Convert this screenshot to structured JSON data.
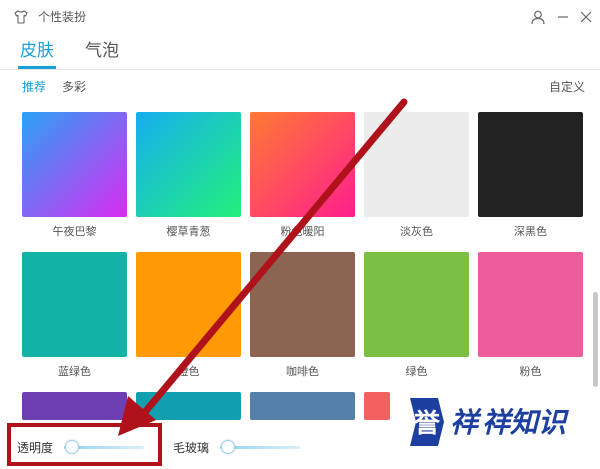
{
  "window": {
    "title": "个性装扮"
  },
  "main_tabs": [
    {
      "label": "皮肤"
    },
    {
      "label": "气泡"
    }
  ],
  "sub_tabs": [
    {
      "label": "推荐"
    },
    {
      "label": "多彩"
    }
  ],
  "custom_label": "自定义",
  "skins": [
    {
      "label": "午夜巴黎",
      "color_from": "#2aa2f5",
      "color_to": "#d92cf2"
    },
    {
      "label": "樱草青葱",
      "color_from": "#16aef0",
      "color_to": "#22f07a"
    },
    {
      "label": "粉色暖阳",
      "color_from": "#ff7a33",
      "color_to": "#ff1e8e"
    },
    {
      "label": "淡灰色",
      "color_from": "#ececec",
      "color_to": "#ececec"
    },
    {
      "label": "深黑色",
      "color_from": "#222222",
      "color_to": "#222222"
    },
    {
      "label": "蓝绿色",
      "color_from": "#12b3a6",
      "color_to": "#12b3a6"
    },
    {
      "label": "橙色",
      "color_from": "#ff9a05",
      "color_to": "#ff9a05"
    },
    {
      "label": "咖啡色",
      "color_from": "#8b6452",
      "color_to": "#8b6452"
    },
    {
      "label": "绿色",
      "color_from": "#7bc044",
      "color_to": "#7bc044"
    },
    {
      "label": "粉色",
      "color_from": "#ee5c9c",
      "color_to": "#ee5c9c"
    },
    {
      "label": "",
      "color_from": "#6d3fb3",
      "color_to": "#6d3fb3"
    },
    {
      "label": "",
      "color_from": "#12a0b0",
      "color_to": "#12a0b0"
    },
    {
      "label": "",
      "color_from": "#5580a8",
      "color_to": "#5580a8"
    },
    {
      "label": "",
      "color_from": "#f26060",
      "color_to": "#f26060"
    }
  ],
  "bottom": {
    "transparency_label": "透明度",
    "transparency_value": 0.1,
    "frosted_glass_label": "毛玻璃",
    "frosted_glass_value": 0.1
  },
  "watermark_text": "誉祥祥知识",
  "colors": {
    "accent": "#1aa0d8",
    "annotation": "#b0121b"
  },
  "icons": {
    "title": "shirt-icon",
    "user": "user-icon",
    "minimize": "minimize-icon",
    "close": "close-icon"
  }
}
